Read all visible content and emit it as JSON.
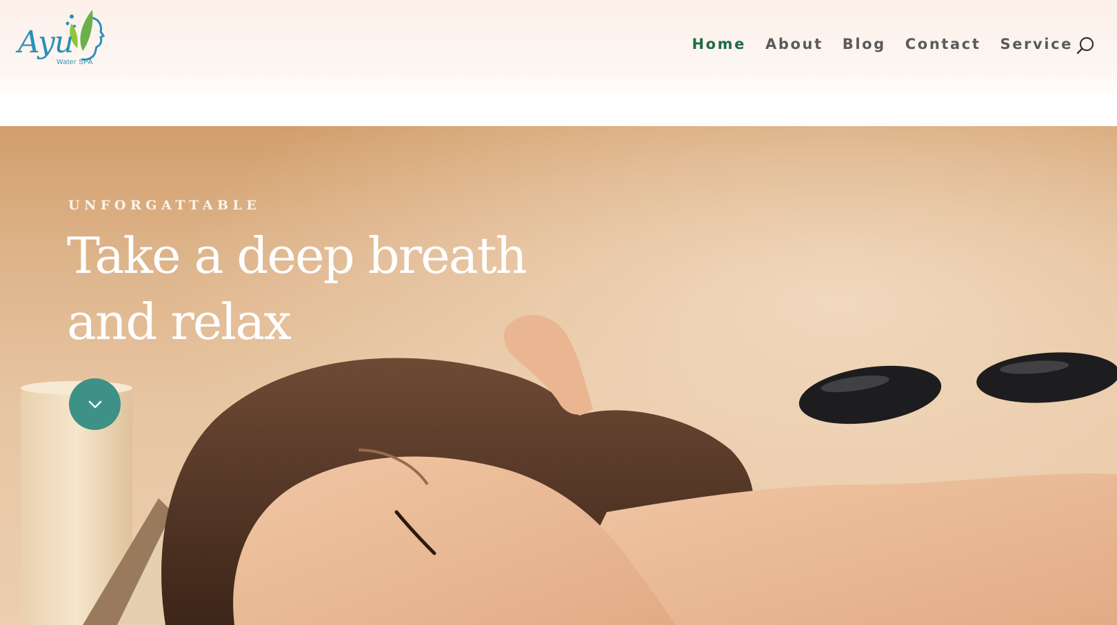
{
  "logo": {
    "name": "Ayu",
    "tagline": "Water SPA"
  },
  "nav": {
    "items": [
      {
        "label": "Home",
        "active": true
      },
      {
        "label": "About",
        "active": false
      },
      {
        "label": "Blog",
        "active": false
      },
      {
        "label": "Contact",
        "active": false
      },
      {
        "label": "Service",
        "active": false
      }
    ],
    "search_icon": "search-icon"
  },
  "hero": {
    "eyebrow": "UNFORGATTABLE",
    "title_line1": "Take a deep breath",
    "title_line2": "and relax",
    "scroll_icon": "chevron-down-icon"
  },
  "colors": {
    "nav_active": "#1f6b45",
    "nav_text": "#5a5a5a",
    "accent_button": "#3e9187",
    "logo_blue": "#2a8fb8",
    "logo_green": "#6ab04c"
  }
}
